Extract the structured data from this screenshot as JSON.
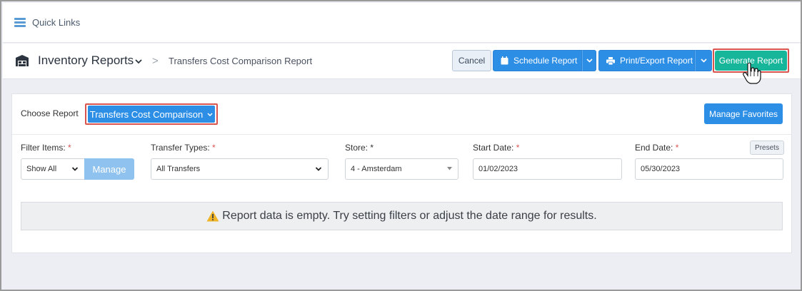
{
  "quicklinks": {
    "label": "Quick Links",
    "icon": "menu-icon"
  },
  "header": {
    "section_title": "Inventory Reports",
    "breadcrumb_sep": ">",
    "report_title": "Transfers Cost Comparison Report",
    "buttons": {
      "cancel": "Cancel",
      "schedule": "Schedule Report",
      "print_export": "Print/Export Report",
      "generate": "Generate Report"
    }
  },
  "panel": {
    "choose_label": "Choose Report",
    "selected_report": "Transfers Cost Comparison",
    "manage_favorites": "Manage Favorites",
    "filters": {
      "filter_items": {
        "label": "Filter Items:",
        "value": "Show All",
        "manage": "Manage"
      },
      "transfer_types": {
        "label": "Transfer Types:",
        "value": "All Transfers"
      },
      "store": {
        "label": "Store:",
        "value": "4 - Amsterdam"
      },
      "start_date": {
        "label": "Start Date:",
        "value": "01/02/2023"
      },
      "end_date": {
        "label": "End Date:",
        "value": "05/30/2023"
      },
      "presets": "Presets"
    },
    "empty_message": "Report data is empty. Try setting filters or adjust the date range for results."
  },
  "colors": {
    "primary": "#2d8ee6",
    "generate": "#17b59a",
    "highlight": "#d9534f",
    "required": "#d9534f",
    "warning": "#f0b429"
  }
}
